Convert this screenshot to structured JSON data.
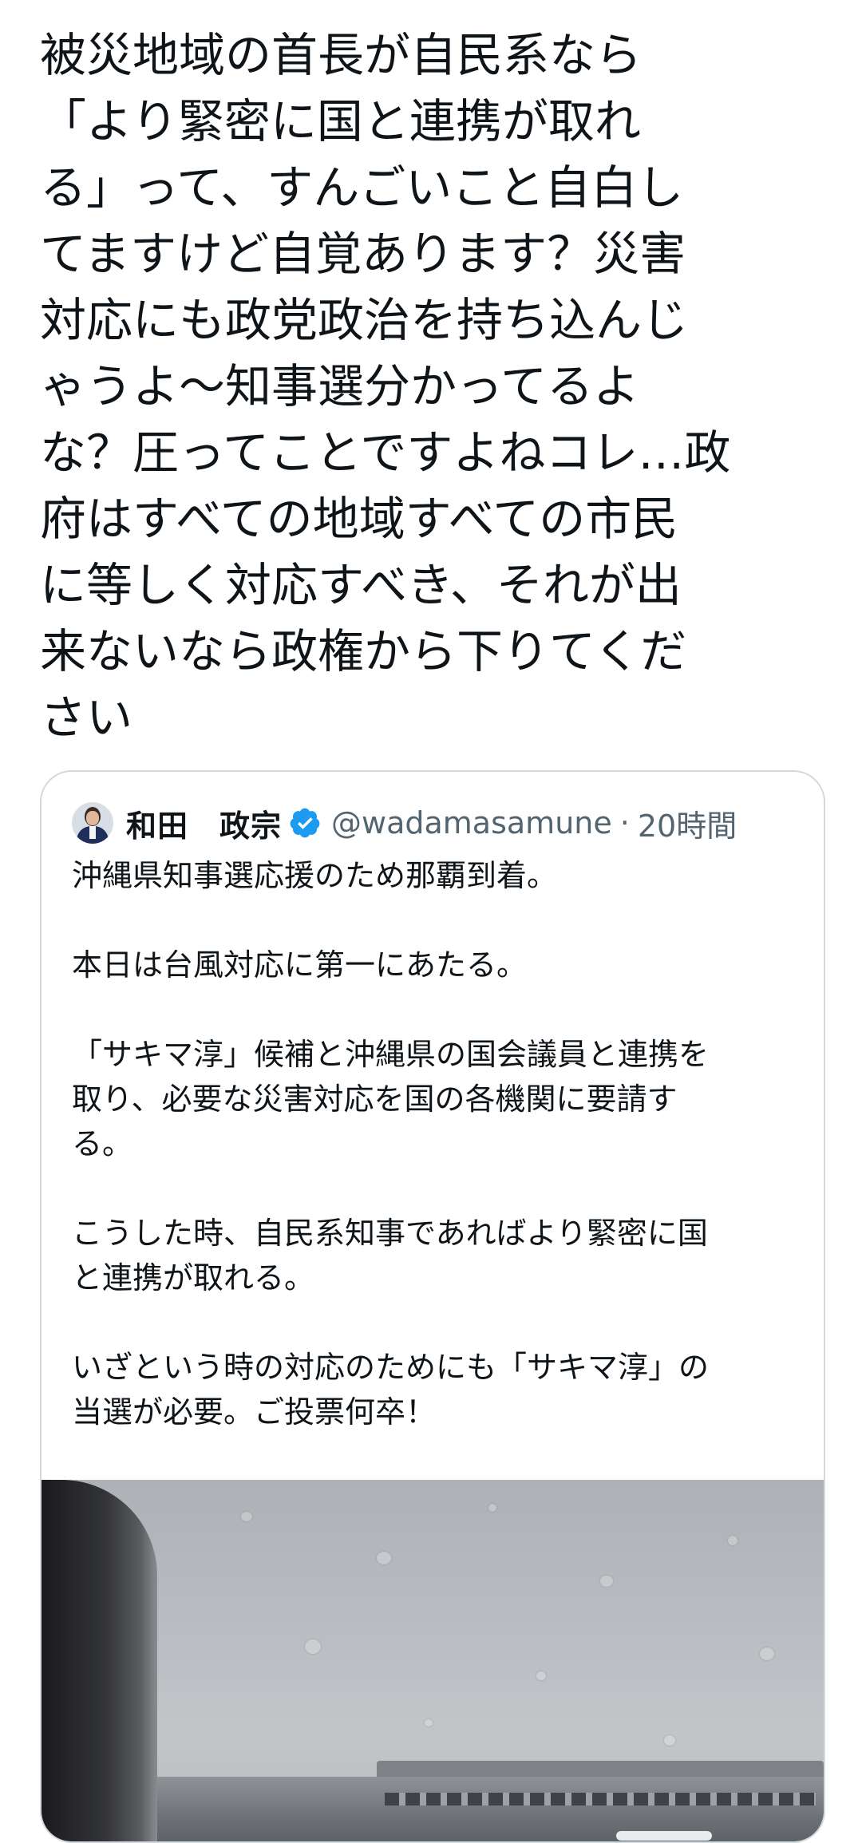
{
  "tweet": {
    "text": "被災地域の首長が自民系なら\n「より緊密に国と連携が取れ\nる」って、すんごいこと自白し\nてますけど自覚あります？災害\n対応にも政党政治を持ち込んじ\nゃうよ〜知事選分かってるよ\nな？圧ってことですよねコレ…政\n府はすべての地域すべての市民\nに等しく対応すべき、それが出\n来ないなら政権から下りてくだ\nさい"
  },
  "quoted_tweet": {
    "display_name": "和田　政宗",
    "handle": "@wadamasamune",
    "separator": "·",
    "timestamp": "20時間",
    "text": "沖縄県知事選応援のため那覇到着。\n\n本日は台風対応に第一にあたる。\n\n「サキマ淳」候補と沖縄県の国会議員と連携を\n取り、必要な災害対応を国の各機関に要請す\nる。\n\nこうした時、自民系知事であればより緊密に国\nと連携が取れる。\n\nいざという時の対応のためにも「サキマ淳」の\n当選が必要。ご投票何卒！",
    "verified_icon": "verified-badge-icon",
    "media_alt": "rainy-airport-window-photo"
  },
  "colors": {
    "text_primary": "#0f1419",
    "text_secondary": "#536471",
    "border": "#cfd9de",
    "verified": "#1d9bf0"
  }
}
